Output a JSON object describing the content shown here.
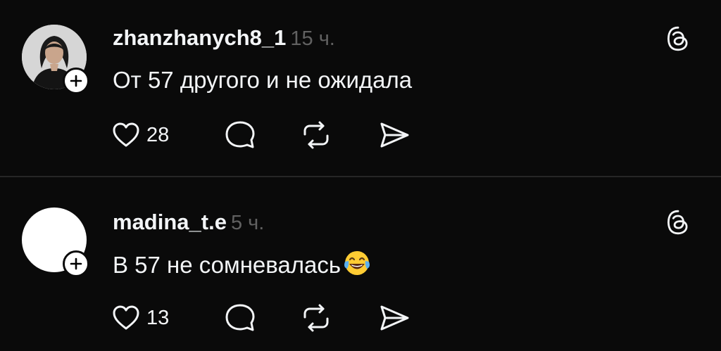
{
  "posts": [
    {
      "username": "zhanzhanych8_1",
      "timestamp": "15 ч.",
      "text": "От 57 другого и не ожидала",
      "like_count": "28",
      "avatar": "photo",
      "icons": {
        "like": "heart-icon",
        "reply": "speech-bubble-icon",
        "repost": "repost-arrows-icon",
        "share": "paper-plane-icon",
        "brand": "threads-logo-icon",
        "follow": "plus-icon"
      }
    },
    {
      "username": "madina_t.e",
      "timestamp": "5 ч.",
      "text": "В 57 не сомневалась",
      "emoji": "face-with-tears-of-joy",
      "like_count": "13",
      "avatar": "blank",
      "icons": {
        "like": "heart-icon",
        "reply": "speech-bubble-icon",
        "repost": "repost-arrows-icon",
        "share": "paper-plane-icon",
        "brand": "threads-logo-icon",
        "follow": "plus-icon"
      }
    }
  ],
  "colors": {
    "background": "#0a0a0a",
    "text_primary": "#f3f5f7",
    "text_secondary": "#616161",
    "divider": "#262626"
  }
}
